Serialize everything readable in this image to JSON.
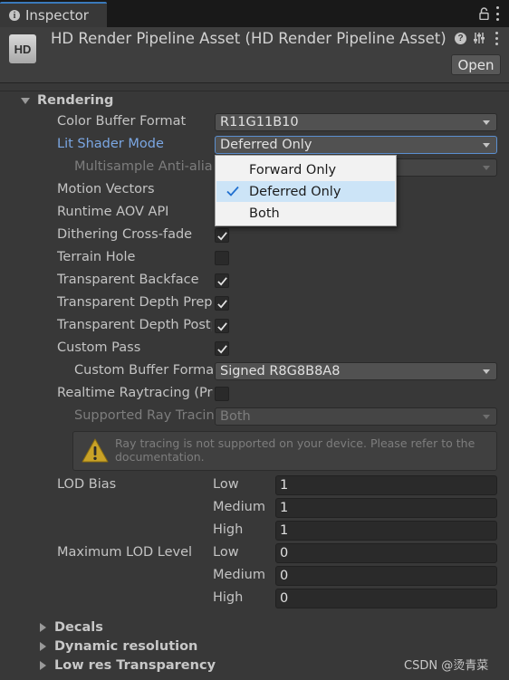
{
  "tab": {
    "title": "Inspector"
  },
  "header": {
    "logo_text": "HD",
    "title": "HD Render Pipeline Asset (HD Render Pipeline Asset)",
    "open_label": "Open"
  },
  "rendering": {
    "section_label": "Rendering",
    "color_buffer_format": {
      "label": "Color Buffer Format",
      "value": "R11G11B10"
    },
    "lit_shader_mode": {
      "label": "Lit Shader Mode",
      "value": "Deferred Only",
      "options": [
        "Forward Only",
        "Deferred Only",
        "Both"
      ],
      "selected_index": 1
    },
    "multisample_label": "Multisample Anti-aliasing",
    "motion_vectors_label": "Motion Vectors",
    "runtime_aov_label": "Runtime AOV API",
    "dithering": {
      "label": "Dithering Cross-fade",
      "checked": true
    },
    "terrain_hole": {
      "label": "Terrain Hole",
      "checked": false
    },
    "transparent_backface": {
      "label": "Transparent Backface",
      "checked": true
    },
    "transparent_depth_prepass": {
      "label": "Transparent Depth Prepass",
      "checked": true
    },
    "transparent_depth_postpass": {
      "label": "Transparent Depth Postpass",
      "checked": true
    },
    "custom_pass": {
      "label": "Custom Pass",
      "checked": true
    },
    "custom_buffer_format": {
      "label": "Custom Buffer Format",
      "value": "Signed R8G8B8A8"
    },
    "realtime_raytracing": {
      "label": "Realtime Raytracing (Preview)",
      "checked": false
    },
    "supported_ray_tracing": {
      "label": "Supported Ray Tracing Mode",
      "value": "Both"
    },
    "warning_text": "Ray tracing is not supported on your device. Please refer to the documentation.",
    "lod_bias": {
      "label": "LOD Bias",
      "rows": [
        {
          "level": "Low",
          "value": "1"
        },
        {
          "level": "Medium",
          "value": "1"
        },
        {
          "level": "High",
          "value": "1"
        }
      ]
    },
    "max_lod_level": {
      "label": "Maximum LOD Level",
      "rows": [
        {
          "level": "Low",
          "value": "0"
        },
        {
          "level": "Medium",
          "value": "0"
        },
        {
          "level": "High",
          "value": "0"
        }
      ]
    }
  },
  "sections": [
    {
      "label": "Decals"
    },
    {
      "label": "Dynamic resolution"
    },
    {
      "label": "Low res Transparency"
    }
  ],
  "watermark": "CSDN @烫青菜",
  "colors": {
    "background": "#383838",
    "accent_blue": "#7ba7e3",
    "popup_selection": "#cce4f7"
  }
}
